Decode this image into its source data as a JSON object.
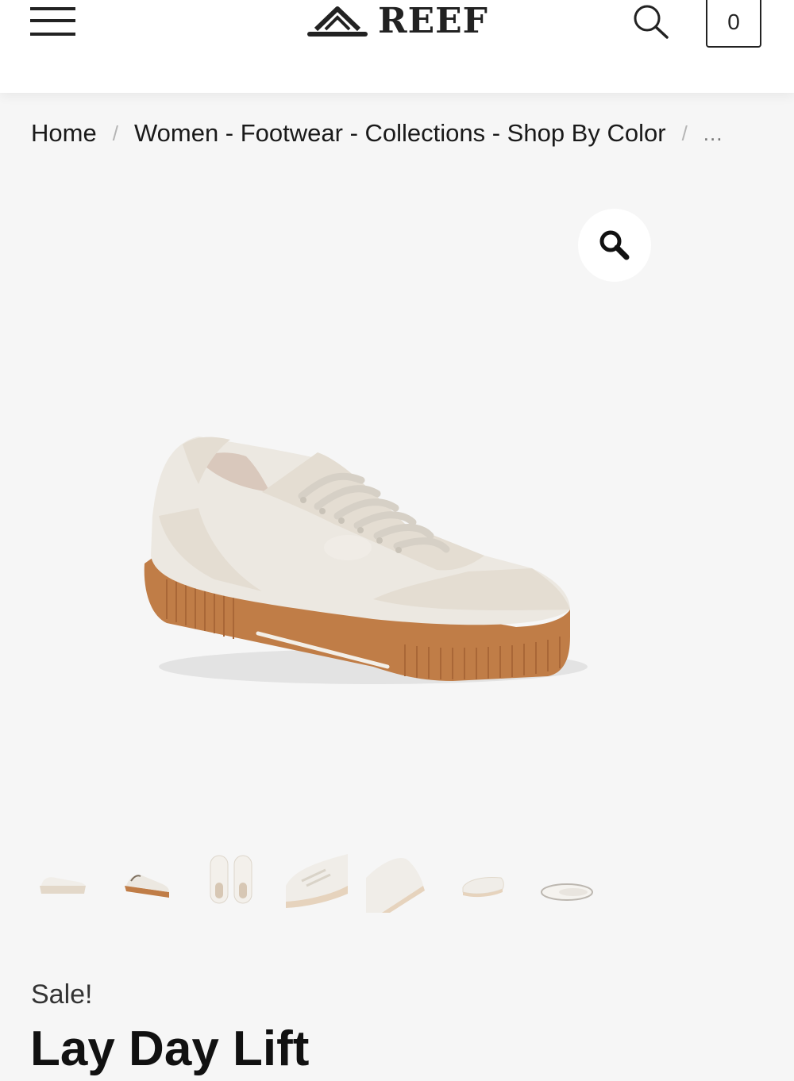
{
  "header": {
    "brand": "REEF",
    "cart_count": "0"
  },
  "breadcrumb": {
    "home": "Home",
    "category": "Women - Footwear - Collections - Shop By Color",
    "separator": "/",
    "ellipsis": "..."
  },
  "gallery": {
    "thumbnails": [
      "thumb-side",
      "thumb-angle",
      "thumb-top",
      "thumb-closeup-front",
      "thumb-closeup-toe",
      "thumb-front",
      "thumb-sole"
    ],
    "colors": {
      "upper": "#ece8e1",
      "sole": "#c07d47",
      "suede": "#e4ddd2",
      "lace": "#e6e1d9"
    }
  },
  "product": {
    "sale_badge": "Sale!",
    "title": "Lay Day Lift"
  }
}
